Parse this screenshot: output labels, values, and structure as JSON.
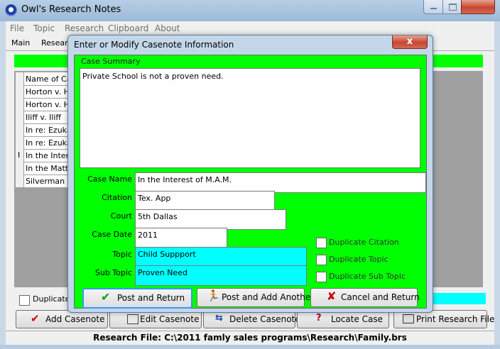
{
  "window": {
    "title": "Owl's Research Notes"
  },
  "menu": [
    "File",
    "Topic",
    "Research",
    "Clipboard",
    "About"
  ],
  "tabs": [
    "Main",
    "Research"
  ],
  "list": {
    "header": "Name of Case",
    "rows": [
      "Horton v. Ho",
      "Horton v. Ho",
      "Iliff v. Iliff",
      "In re: Ezukan",
      "In re: Ezukan",
      "In the Interes",
      "In the Matter",
      "Silverman v."
    ]
  },
  "main_checkbox_label": "Duplicate C",
  "main_buttons": {
    "add": "Add Casenote",
    "edit": "Edit Casenote",
    "delete": "Delete Casenote",
    "locate": "Locate Case",
    "print": "Print Research File"
  },
  "status": "Research File: C:\\2011 famly sales programs\\Research\\Family.brs",
  "dialog": {
    "title": "Enter or Modify Casenote Information",
    "close_glyph": "x",
    "summary_legend": "Case Summary",
    "summary_text": "Private School is not a proven need.",
    "labels": {
      "case_name": "Case Name",
      "citation": "Citation",
      "court": "Court",
      "case_date": "Case Date",
      "topic": "Topic",
      "sub_topic": "Sub Topic"
    },
    "values": {
      "case_name": "In the Interest of M.A.M.",
      "citation": "Tex. App",
      "court": "5th Dallas",
      "case_date": "2011",
      "topic": "Child Suppport",
      "sub_topic": "Proven Need"
    },
    "checkboxes": [
      "Duplicate Citation",
      "Duplicate Topic",
      "Duplicate Sub Topic"
    ],
    "buttons": {
      "post_return": "Post and Return",
      "post_add": "Post and Add Another",
      "cancel": "Cancel and Return"
    }
  },
  "colors": {
    "form_bg": "#00ff00",
    "highlight_field": "#00ffff"
  }
}
